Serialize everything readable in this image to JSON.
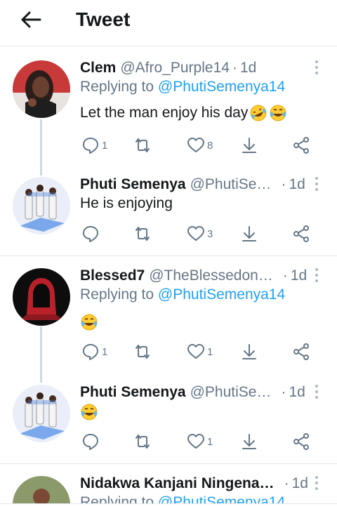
{
  "header": {
    "title": "Tweet"
  },
  "tweets": [
    {
      "name": "Clem",
      "handle": "@Afro_Purple14",
      "sep": "·",
      "time": "1d",
      "replying_prefix": "Replying to",
      "replying_handle": "@PhutiSemenya14",
      "text": "Let the man enjoy his day",
      "emojis": [
        "rofl",
        "joy"
      ],
      "replies": "1",
      "retweets": "",
      "likes": "8"
    },
    {
      "name": "Phuti Semenya",
      "handle": "@PhutiSe…",
      "sep": "·",
      "time": "1d",
      "text": "He is enjoying",
      "emojis": [],
      "replies": "",
      "retweets": "",
      "likes": "3"
    },
    {
      "name": "Blessed7",
      "handle": "@TheBlessedon…",
      "sep": "·",
      "time": "1d",
      "replying_prefix": "Replying to",
      "replying_handle": "@PhutiSemenya14",
      "text": "",
      "emojis": [
        "joy"
      ],
      "replies": "1",
      "retweets": "",
      "likes": "1"
    },
    {
      "name": "Phuti Semenya",
      "handle": "@PhutiSe…",
      "sep": "·",
      "time": "1d",
      "text": "",
      "emojis": [
        "joy"
      ],
      "replies": "",
      "retweets": "",
      "likes": "1"
    },
    {
      "name": "Nidakwa Kanjani Ningena…",
      "sep": "·",
      "time": "1d",
      "replying_prefix": "Replying to",
      "replying_handle": "@PhutiSemenya14"
    }
  ],
  "colors": {
    "accent": "#1da1f2",
    "muted": "#657786",
    "text": "#14171a",
    "divider": "#e1e8ed"
  }
}
